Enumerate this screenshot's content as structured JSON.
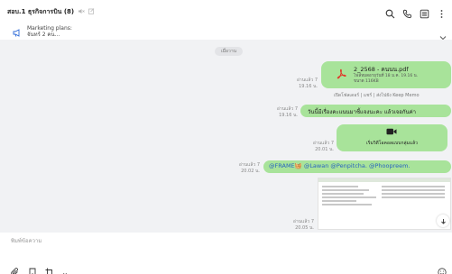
{
  "header": {
    "title": "สอบ.1 ธุรกิจการบิน (8)",
    "mute_icon": "muted-icon",
    "note_icon": "note-icon",
    "actions": [
      "search-icon",
      "phone-icon",
      "menu-icon",
      "more-icon"
    ]
  },
  "announcement": {
    "line1": "Marketing plans:",
    "line2": "จันทร์ 2 คน..."
  },
  "chat": {
    "date_separator": "เมื่อวาน",
    "messages": [
      {
        "type": "file",
        "read": "อ่านแล้ว 7",
        "time": "19.16 น.",
        "file_name": "2_2568 - คนนน.pdf",
        "file_expiry": "ไฟล์หมดอายุวันที่ 18 ม.ค. 19.16 น.",
        "file_size": "ขนาด 116KB",
        "actions": "เปิดโฟลเดอร์ | แชร์ | ส่งไปยัง Keep Memo"
      },
      {
        "type": "text",
        "read": "อ่านแล้ว 7",
        "time": "19.16 น.",
        "text": "วันนี้มีเรื่องคะแนนมาชี้แจงนะคะ แล้วเจอกันค่า"
      },
      {
        "type": "call",
        "read": "อ่านแล้ว 7",
        "time": "20.01 น.",
        "label": "เริ่มวิดีโอคอลแบบกลุ่มแล้ว"
      },
      {
        "type": "mention",
        "read": "อ่านแล้ว 7",
        "time": "20.02 น.",
        "text": "@FRAME🧺 @Lawan @Penpitcha. @Phoopreem."
      },
      {
        "type": "image",
        "read": "อ่านแล้ว 7",
        "time": "20.05 น."
      }
    ]
  },
  "input": {
    "placeholder": "พิมพ์ข้อความ"
  },
  "colors": {
    "bubble": "#a8e39a",
    "chat_bg": "#f1f2f4",
    "mention": "#2a64c0",
    "accent": "#2f6bd8",
    "pdf_red": "#e0392b"
  }
}
